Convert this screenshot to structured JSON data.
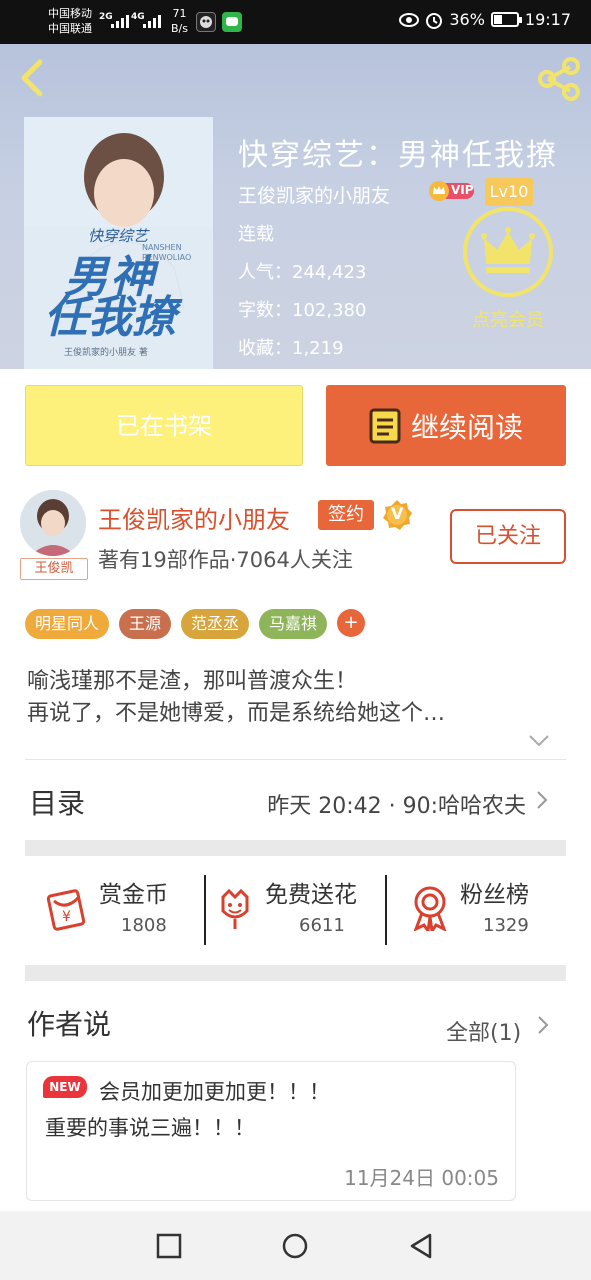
{
  "status_bar": {
    "carrier1": "中国移动",
    "carrier2": "中国联通",
    "sig1": "2G",
    "sig2": "4G",
    "net_speed_value": "71",
    "net_speed_unit": "B/s",
    "battery_percent": "36%",
    "battery_level": 0.36,
    "time": "19:17",
    "icons": [
      "eye-icon",
      "alarm-icon",
      "battery-icon"
    ]
  },
  "header": {
    "book_title": "快穿综艺：男神任我撩",
    "author": "王俊凯家的小朋友",
    "vip_label": "VIP",
    "level": "Lv10",
    "status": "连载",
    "popularity": "人气：244,423",
    "word_count": "字数：102,380",
    "favorites": "收藏：1,219",
    "member_label": "点亮会员",
    "cover": {
      "series_label": "快穿综艺",
      "title_line1": "男神",
      "title_line2": "任我撩",
      "pinyin": "NANSHEN RENWOLIAO",
      "credit": "王俊凯家的小朋友 著"
    }
  },
  "actions": {
    "on_shelf_label": "已在书架",
    "continue_label": "继续阅读"
  },
  "author": {
    "name": "王俊凯家的小朋友",
    "sign_label": "签约",
    "v_label": "V",
    "avatar_tag": "王俊凯",
    "stats": "著有19部作品·7064人关注",
    "follow_label": "已关注"
  },
  "tags": [
    {
      "label": "明星同人",
      "color": "#f0a93b"
    },
    {
      "label": "王源",
      "color": "#c8704e"
    },
    {
      "label": "范丞丞",
      "color": "#d7a53c"
    },
    {
      "label": "马嘉祺",
      "color": "#8fb55a"
    }
  ],
  "tag_add_label": "+",
  "synopsis": {
    "line1": "喻浅瑾那不是渣，那叫普渡众生！",
    "line2": "再说了，不是她博爱，而是系统给她这个…"
  },
  "toc": {
    "title": "目录",
    "latest": "昨天 20:42 · 90:哈哈农夫"
  },
  "stats": [
    {
      "label": "赏金币",
      "value": "1808",
      "icon": "red-envelope-icon"
    },
    {
      "label": "免费送花",
      "value": "6611",
      "icon": "flower-icon"
    },
    {
      "label": "粉丝榜",
      "value": "1329",
      "icon": "medal-icon"
    }
  ],
  "author_says": {
    "title": "作者说",
    "all_label": "全部(1)",
    "note": {
      "new_label": "NEW",
      "line1": "会员加更加更加更！！！",
      "line2": "重要的事说三遍！！！",
      "date": "11月24日   00:05"
    }
  },
  "colors": {
    "accent": "#e8673a",
    "author_red": "#d9502e",
    "shelf_yellow": "#fdf17c",
    "crown_yellow": "#f2e46a"
  }
}
